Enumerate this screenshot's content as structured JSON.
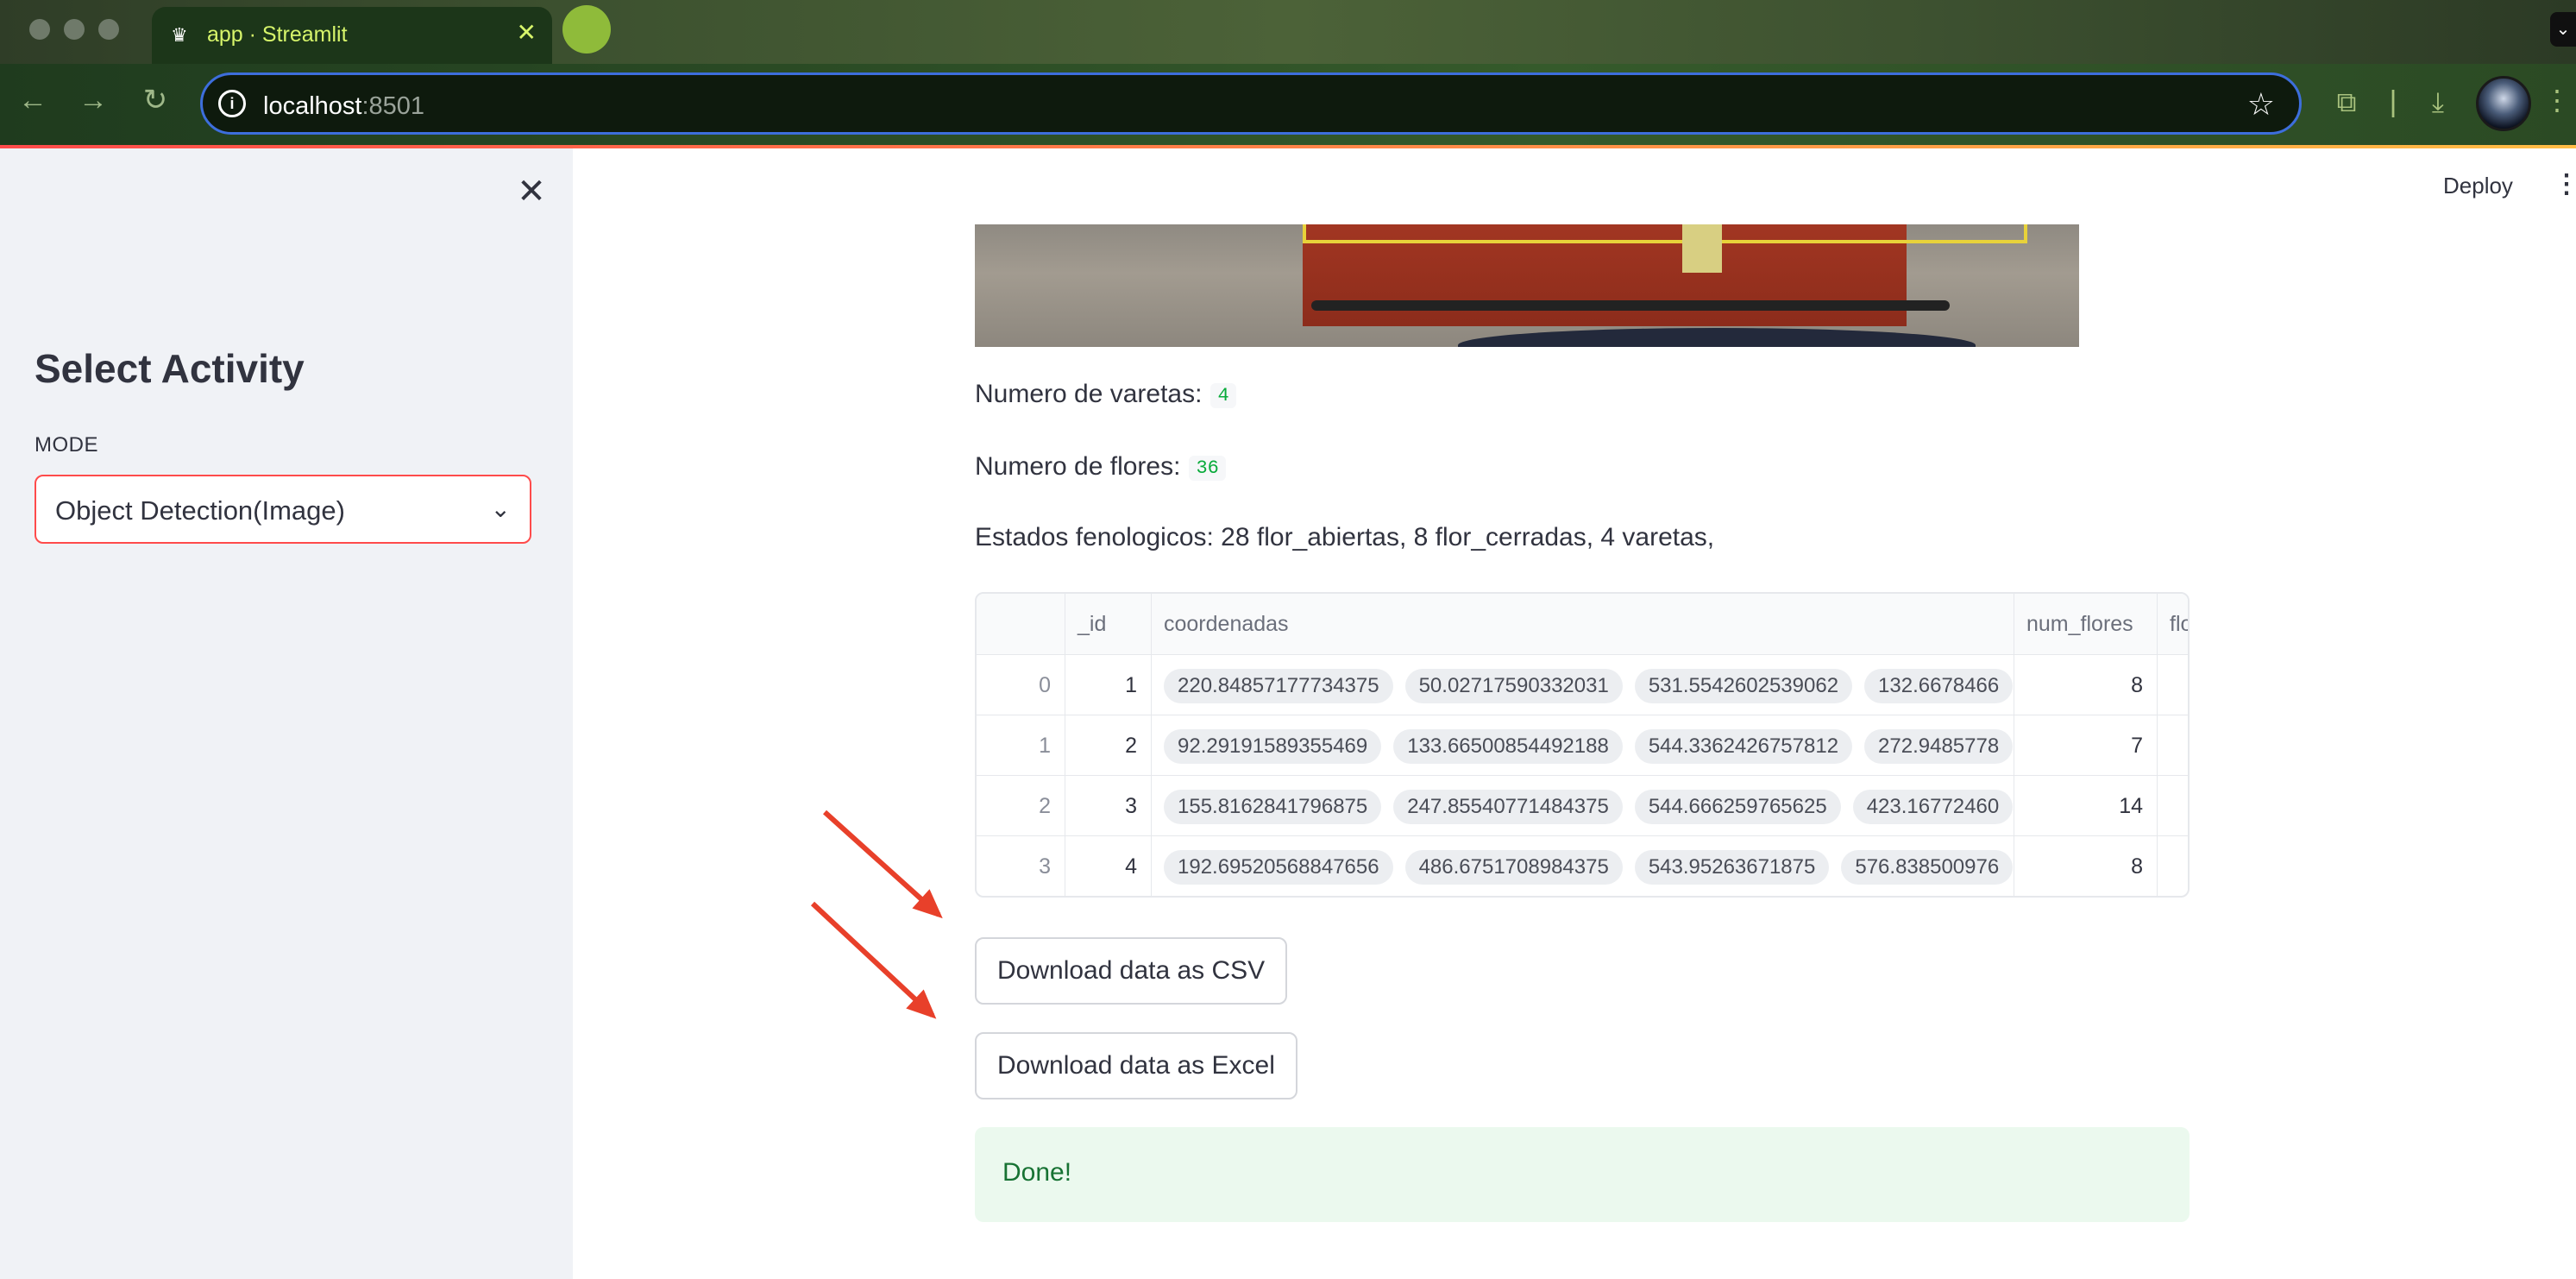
{
  "browser": {
    "tab_title": "app · Streamlit",
    "tab_favicon": "streamlit-crown-icon",
    "url_host": "localhost",
    "url_port": ":8501"
  },
  "sidebar": {
    "title": "Select Activity",
    "mode_label": "MODE",
    "mode_value": "Object Detection(Image)"
  },
  "header": {
    "deploy_label": "Deploy"
  },
  "stats": {
    "varetas_label": "Numero de varetas:",
    "varetas_value": "4",
    "flores_label": "Numero de flores:",
    "flores_value": "36",
    "estados": "Estados fenologicos: 28 flor_abiertas, 8 flor_cerradas, 4 varetas,"
  },
  "table": {
    "columns": [
      "",
      "_id",
      "coordenadas",
      "num_flores",
      "flo"
    ],
    "rows": [
      {
        "index": "0",
        "id": "1",
        "coords": [
          "220.84857177734375",
          "50.02717590332031",
          "531.5542602539062",
          "132.6678466"
        ],
        "num_flores": "8"
      },
      {
        "index": "1",
        "id": "2",
        "coords": [
          "92.29191589355469",
          "133.66500854492188",
          "544.3362426757812",
          "272.9485778"
        ],
        "num_flores": "7"
      },
      {
        "index": "2",
        "id": "3",
        "coords": [
          "155.8162841796875",
          "247.85540771484375",
          "544.666259765625",
          "423.16772460"
        ],
        "num_flores": "14"
      },
      {
        "index": "3",
        "id": "4",
        "coords": [
          "192.69520568847656",
          "486.6751708984375",
          "543.95263671875",
          "576.838500976"
        ],
        "num_flores": "8"
      }
    ]
  },
  "buttons": {
    "csv": "Download data as CSV",
    "excel": "Download data as Excel"
  },
  "status": {
    "message": "Done!"
  },
  "colors": {
    "accent": "#ff4b4b",
    "success_bg": "#ebf9ee",
    "success_text": "#177233",
    "annotation_arrow": "#e8402a"
  }
}
